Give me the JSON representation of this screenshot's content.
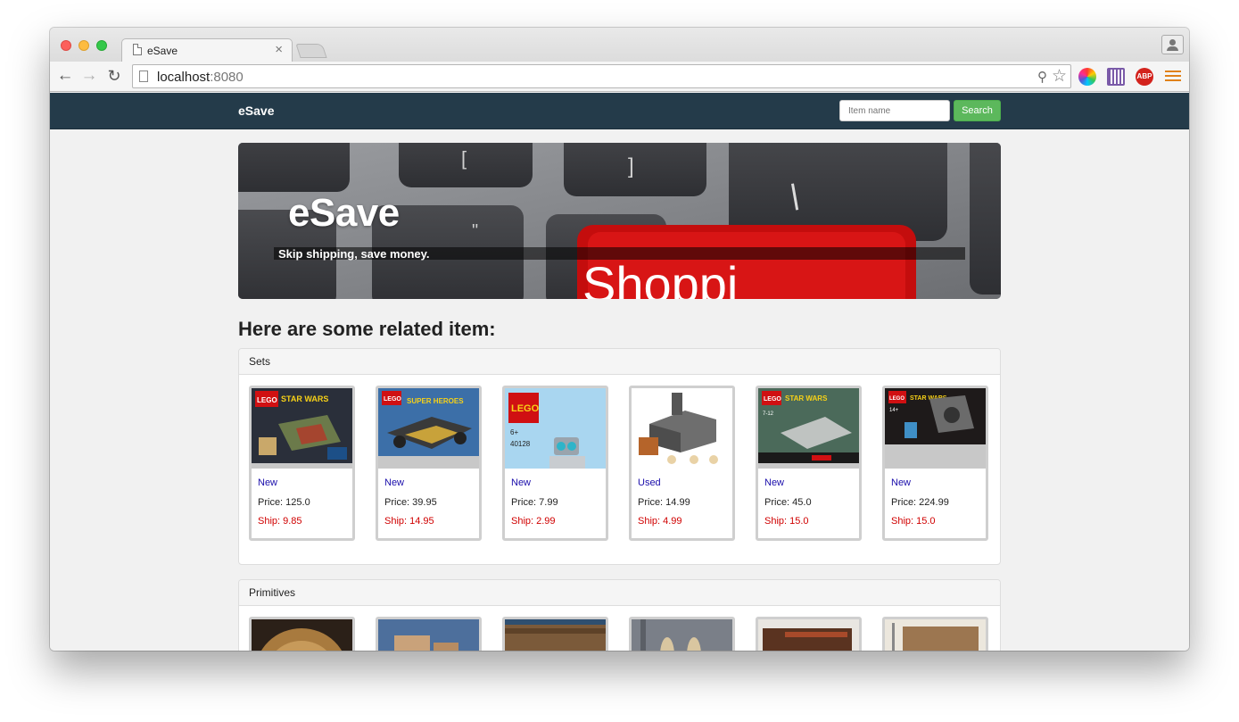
{
  "browser": {
    "tab_title": "eSave",
    "tab_close": "×",
    "url_host": "localhost",
    "url_port": ":8080",
    "extensions": {
      "abp_label": "ABP"
    }
  },
  "site": {
    "brand": "eSave",
    "search": {
      "placeholder": "Item name",
      "button_label": "Search"
    },
    "hero": {
      "title": "eSave",
      "subtitle": "Skip shipping, save money.",
      "key_text": "Shoppi"
    },
    "section_title": "Here are some related item:"
  },
  "panels": [
    {
      "heading": "Sets",
      "items": [
        {
          "condition": "New",
          "price": "Price: 125.0",
          "ship": "Ship: 9.85"
        },
        {
          "condition": "New",
          "price": "Price: 39.95",
          "ship": "Ship: 14.95"
        },
        {
          "condition": "New",
          "price": "Price: 7.99",
          "ship": "Ship: 2.99"
        },
        {
          "condition": "Used",
          "price": "Price: 14.99",
          "ship": "Ship: 4.99"
        },
        {
          "condition": "New",
          "price": "Price: 45.0",
          "ship": "Ship: 15.0"
        },
        {
          "condition": "New",
          "price": "Price: 224.99",
          "ship": "Ship: 15.0"
        }
      ]
    },
    {
      "heading": "Primitives",
      "items": []
    }
  ],
  "images": {
    "lego_1": {
      "brand": "LEGO",
      "line": "STAR WARS"
    },
    "lego_2": {
      "brand": "LEGO",
      "line": "SUPER HEROES"
    },
    "lego_3": {
      "brand": "LEGO",
      "age": "6+",
      "set": "40128"
    },
    "lego_5": {
      "brand": "LEGO",
      "line": "STAR WARS",
      "age": "7-12"
    },
    "lego_6": {
      "brand": "LEGO",
      "line": "STAR WARS",
      "age": "14+"
    }
  },
  "colors": {
    "navbar": "#243b4a",
    "search_button": "#5cb85c",
    "condition": "#1a0dab",
    "ship": "#d00000"
  }
}
